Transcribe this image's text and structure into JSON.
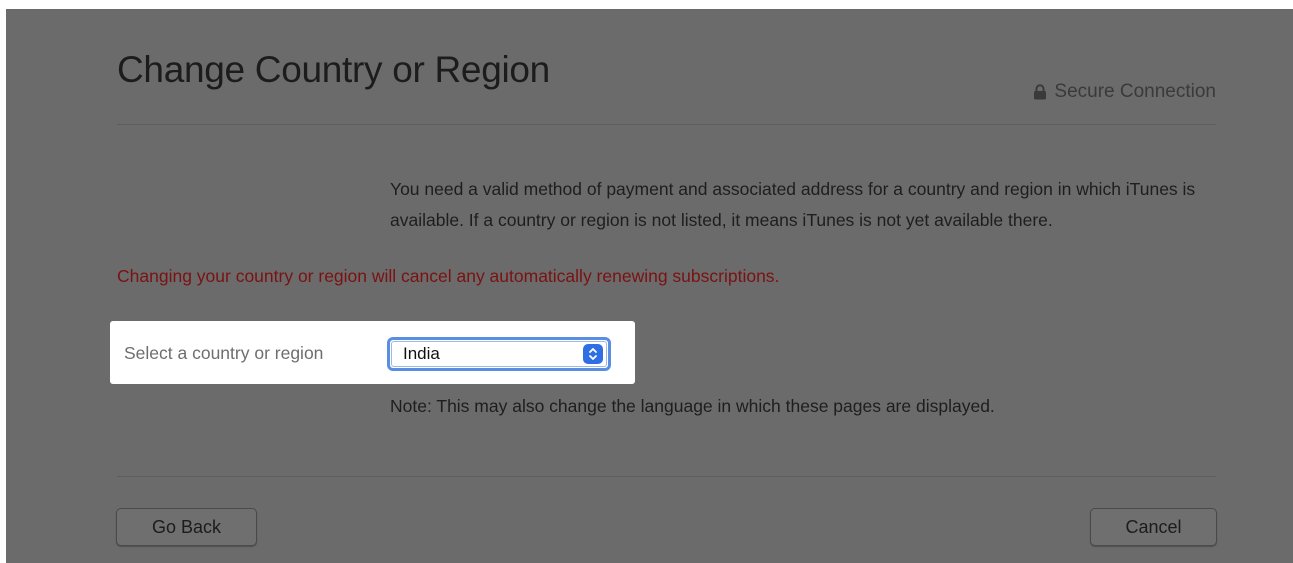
{
  "header": {
    "title": "Change Country or Region",
    "secure_label": "Secure Connection"
  },
  "main": {
    "info_text": "You need a valid method of payment and associated address for a country and region in which iTunes is available. If a country or region is not listed, it means iTunes is not yet available there.",
    "warning_text": "Changing your country or region will cancel any automatically renewing subscriptions.",
    "select_label": "Select a country or region",
    "selected_country": "India",
    "note_text": "Note: This may also change the language in which these pages are displayed."
  },
  "footer": {
    "back_label": "Go Back",
    "cancel_label": "Cancel"
  },
  "colors": {
    "overlay": "#6b6b6b",
    "warning": "#7a1212",
    "select_accent": "#2f6fe3",
    "highlight": "#ffffff"
  },
  "icons": {
    "secure": "lock-icon",
    "select": "chevron-up-down-icon"
  }
}
